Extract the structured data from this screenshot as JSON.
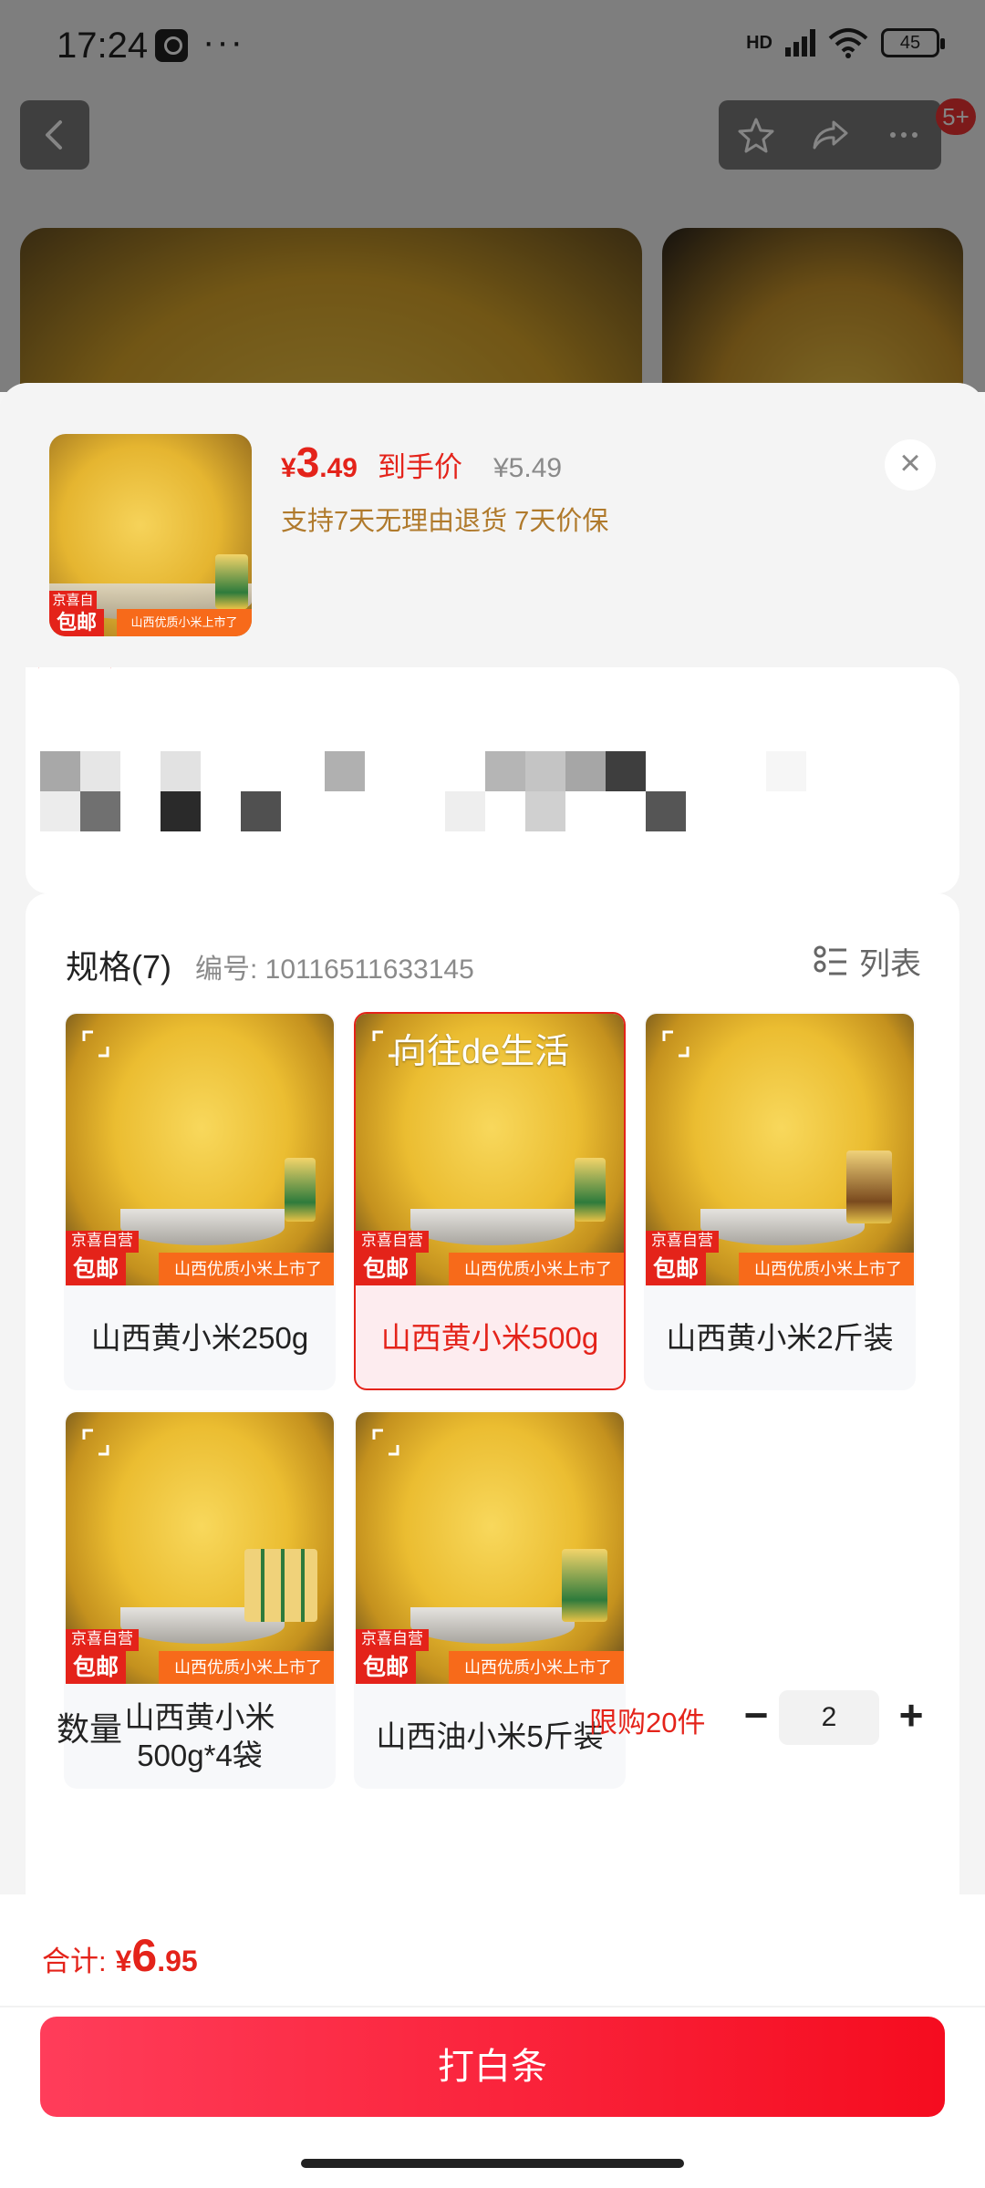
{
  "status_bar": {
    "time": "17:24",
    "dots": "···",
    "network": "HD",
    "battery": "45"
  },
  "nav": {
    "badge": "5+"
  },
  "header": {
    "price_symbol": "¥",
    "price_int": "3",
    "price_dec": ".49",
    "price_label": "到手价",
    "original_price": "¥5.49",
    "promo": "支持7天无理由退货  7天价保",
    "close": "×"
  },
  "thumb_tags": {
    "self": "京喜自营",
    "ship": "包邮",
    "banner": "山西优质小米上市了"
  },
  "spec": {
    "title": "规格(7)",
    "number": "编号: 10116511633145",
    "list_label": "列表",
    "watermark": "向往de生活",
    "items": [
      {
        "label": "山西黄小米250g",
        "selected": false
      },
      {
        "label": "山西黄小米500g",
        "selected": true
      },
      {
        "label": "山西黄小米2斤装",
        "selected": false
      },
      {
        "label": "山西黄小米\n500g*4袋",
        "selected": false
      },
      {
        "label": "山西油小米5斤装",
        "selected": false
      }
    ]
  },
  "quantity": {
    "label": "数量",
    "limit": "限购20件",
    "minus": "−",
    "value": "2",
    "plus": "+"
  },
  "footer": {
    "total_label": "合计:",
    "total_symbol": "¥",
    "total_int": "6",
    "total_dec": ".95",
    "cta_label": "打白条"
  },
  "colors": {
    "accent": "#e4231a",
    "promo": "#b07a2c",
    "banner": "#f76a1a"
  },
  "icons": [
    "back-icon",
    "star-icon",
    "share-icon",
    "more-icon",
    "close-icon",
    "list-icon",
    "expand-icon"
  ]
}
